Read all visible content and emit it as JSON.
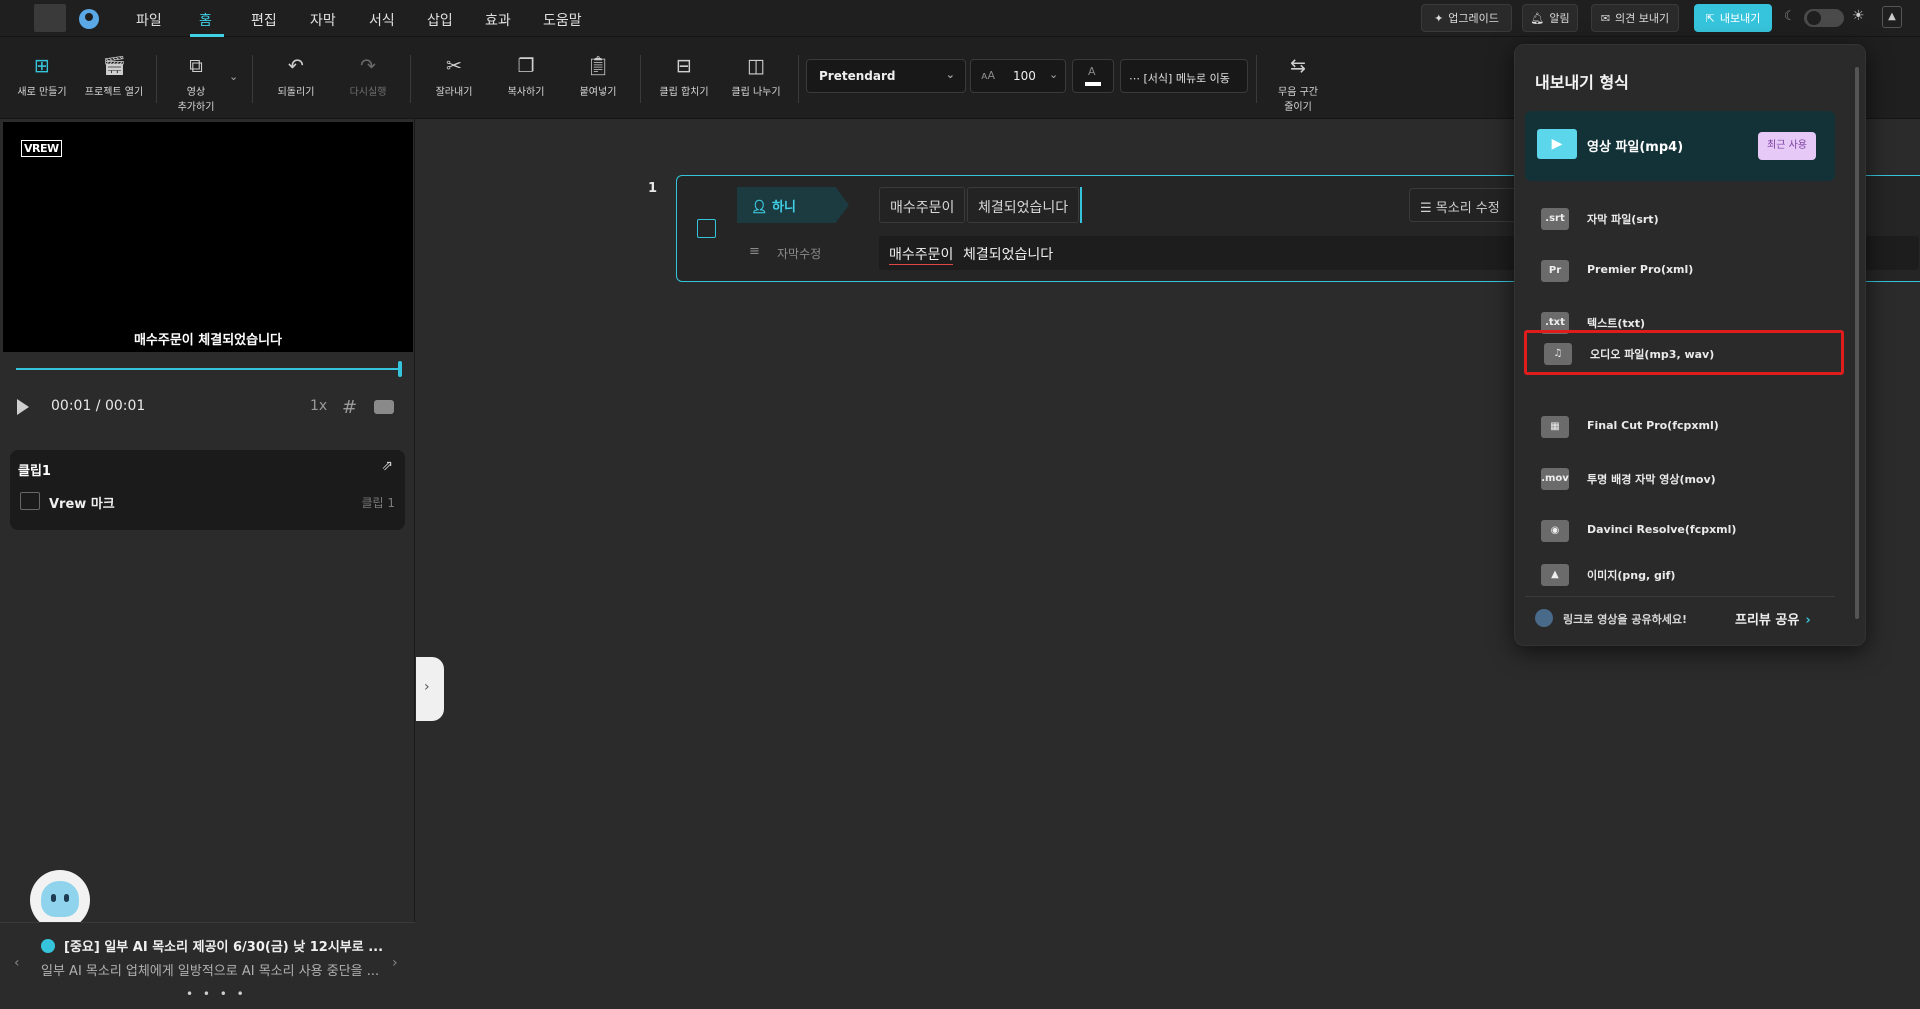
{
  "menubar": {
    "items": [
      "파일",
      "홈",
      "편집",
      "자막",
      "서식",
      "삽입",
      "효과",
      "도움말"
    ],
    "active": "홈",
    "buttons": {
      "upgrade": "업그레이드",
      "notify": "알림",
      "feedback": "의견 보내기",
      "export": "내보내기"
    }
  },
  "toolbar": {
    "new": "새로 만들기",
    "open_project": "프로젝트 열기",
    "add_video_1": "영상",
    "add_video_2": "추가하기",
    "undo": "되돌리기",
    "redo": "다시실행",
    "cut": "잘라내기",
    "copy": "복사하기",
    "paste": "붙여넣기",
    "merge": "클립 합치기",
    "split": "클립 나누기",
    "font": "Pretendard",
    "font_size": "100",
    "format_menu": "[서식] 메뉴로 이동",
    "silence_1": "무음 구간",
    "silence_2": "줄이기"
  },
  "preview": {
    "watermark": "VREW",
    "caption": "매수주문이 체결되었습니다",
    "time": "00:01 / 00:01",
    "speed": "1x",
    "progress": 1.0
  },
  "clip_panel": {
    "title": "클립1",
    "row_label": "Vrew 마크",
    "row_tag": "클립 1"
  },
  "notice": {
    "title": "[중요] 일부 AI 목소리 제공이 6/30(금) 낮 12시부로 ...",
    "body": "일부 AI 목소리 업체에게 일방적으로 AI 목소리 사용 중단을 ...",
    "dots": "• • • •"
  },
  "editor": {
    "clip_number": "1",
    "speaker": "하니",
    "words": [
      "매수주문이",
      "체결되었습니다"
    ],
    "voice_button": "목소리 수정",
    "subtitle_label": "자막수정",
    "subtitle_a": "매수주문이",
    "subtitle_b": "체결되었습니다"
  },
  "export_panel": {
    "title": "내보내기 형식",
    "recent_badge": "최근 사용",
    "items": [
      {
        "icon": "▶",
        "label": "영상 파일(mp4)"
      },
      {
        "icon": ".srt",
        "label": "자막 파일(srt)"
      },
      {
        "icon": "Pr",
        "label": "Premier Pro(xml)"
      },
      {
        "icon": ".txt",
        "label": "텍스트(txt)"
      },
      {
        "icon": "♫",
        "label": "오디오 파일(mp3, wav)"
      },
      {
        "icon": "▦",
        "label": "Final Cut Pro(fcpxml)"
      },
      {
        "icon": ".mov",
        "label": "투명 배경 자막 영상(mov)"
      },
      {
        "icon": "◉",
        "label": "Davinci Resolve(fcpxml)"
      },
      {
        "icon": "▲",
        "label": "이미지(png, gif)"
      }
    ],
    "share_text": "링크로 영상을 공유하세요!",
    "share_button": "프리뷰 공유"
  },
  "colors": {
    "accent": "#36c4dc",
    "highlight_border": "#e01d1d",
    "recent_badge": "#e6c9f7"
  }
}
